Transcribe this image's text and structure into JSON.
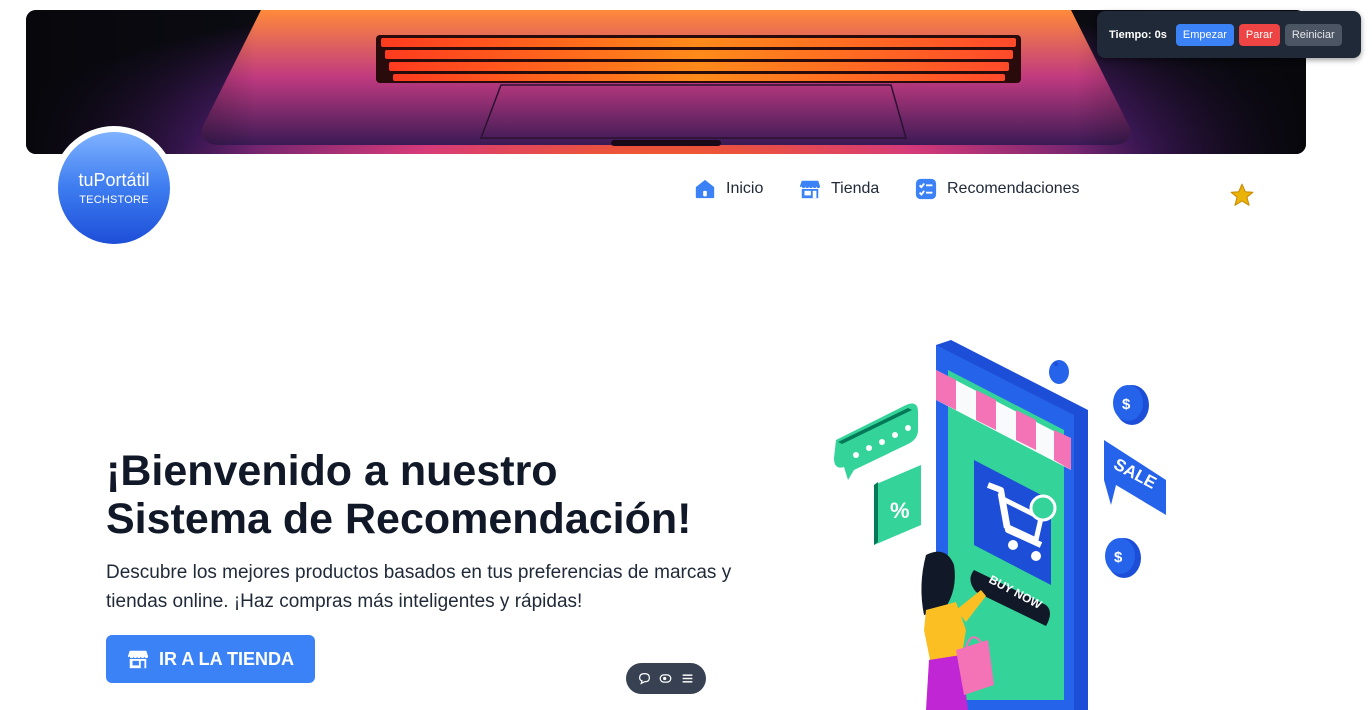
{
  "timer": {
    "label": "Tiempo: 0s",
    "start": "Empezar",
    "stop": "Parar",
    "reset": "Reiniciar"
  },
  "logo": {
    "name": "tuPortátil",
    "tagline": "TECHSTORE"
  },
  "nav": {
    "items": [
      {
        "label": "Inicio",
        "icon": "home-icon"
      },
      {
        "label": "Tienda",
        "icon": "store-icon"
      },
      {
        "label": "Recomendaciones",
        "icon": "checklist-icon"
      }
    ],
    "favorite_icon": "star-icon"
  },
  "hero": {
    "headline_line1": "¡Bienvenido a nuestro",
    "headline_line2": "Sistema de Recomendación!",
    "subtitle_line1": "Descubre los mejores productos basados en tus preferencias de marcas y",
    "subtitle_line2": "tiendas online. ¡Haz compras más inteligentes y rápidas!",
    "cta_label": "IR A LA TIENDA"
  },
  "illustration": {
    "sale_text": "SALE",
    "buy_text": "BUY NOW",
    "percent_text": "%",
    "dollar_text": "$"
  },
  "toolbar_pill": {
    "icons": [
      "comment-icon",
      "eye-icon",
      "menu-icon"
    ]
  },
  "colors": {
    "accent": "#3b82f6",
    "danger": "#ef4444",
    "dark": "#1f2937",
    "star": "#eab308"
  }
}
